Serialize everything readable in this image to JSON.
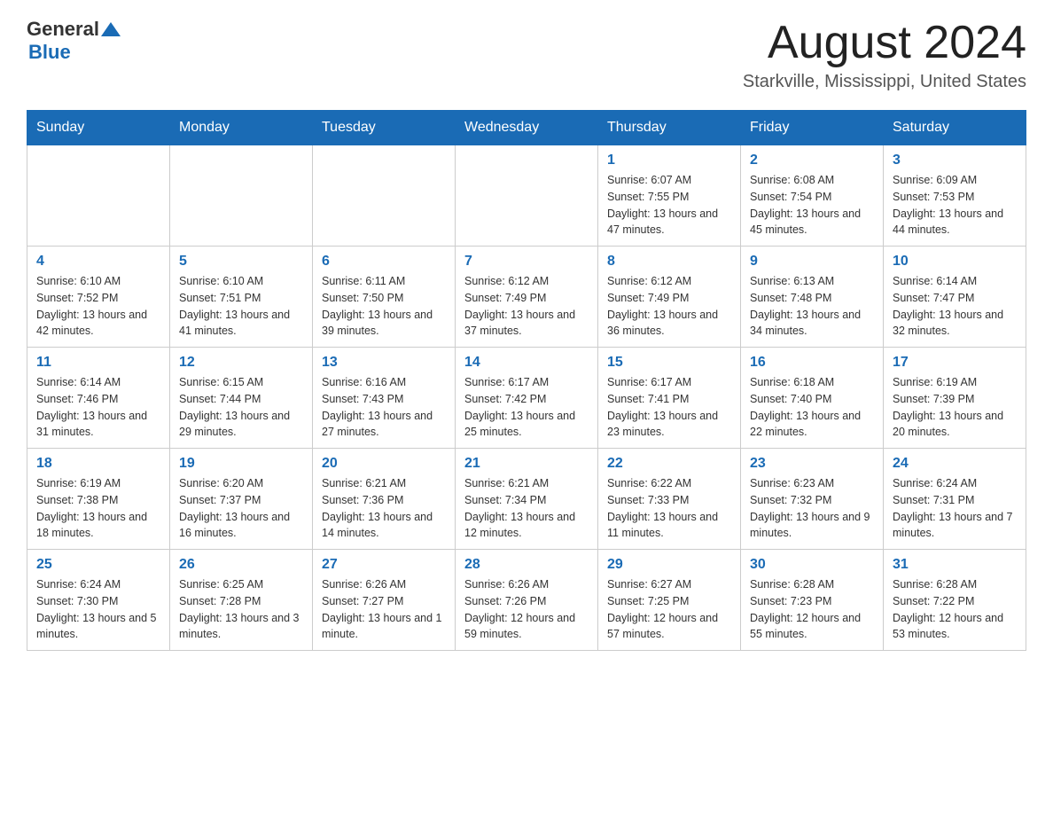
{
  "header": {
    "logo": {
      "general": "General",
      "blue": "Blue"
    },
    "title": "August 2024",
    "subtitle": "Starkville, Mississippi, United States"
  },
  "calendar": {
    "days_of_week": [
      "Sunday",
      "Monday",
      "Tuesday",
      "Wednesday",
      "Thursday",
      "Friday",
      "Saturday"
    ],
    "weeks": [
      [
        {
          "day": "",
          "info": ""
        },
        {
          "day": "",
          "info": ""
        },
        {
          "day": "",
          "info": ""
        },
        {
          "day": "",
          "info": ""
        },
        {
          "day": "1",
          "info": "Sunrise: 6:07 AM\nSunset: 7:55 PM\nDaylight: 13 hours and 47 minutes."
        },
        {
          "day": "2",
          "info": "Sunrise: 6:08 AM\nSunset: 7:54 PM\nDaylight: 13 hours and 45 minutes."
        },
        {
          "day": "3",
          "info": "Sunrise: 6:09 AM\nSunset: 7:53 PM\nDaylight: 13 hours and 44 minutes."
        }
      ],
      [
        {
          "day": "4",
          "info": "Sunrise: 6:10 AM\nSunset: 7:52 PM\nDaylight: 13 hours and 42 minutes."
        },
        {
          "day": "5",
          "info": "Sunrise: 6:10 AM\nSunset: 7:51 PM\nDaylight: 13 hours and 41 minutes."
        },
        {
          "day": "6",
          "info": "Sunrise: 6:11 AM\nSunset: 7:50 PM\nDaylight: 13 hours and 39 minutes."
        },
        {
          "day": "7",
          "info": "Sunrise: 6:12 AM\nSunset: 7:49 PM\nDaylight: 13 hours and 37 minutes."
        },
        {
          "day": "8",
          "info": "Sunrise: 6:12 AM\nSunset: 7:49 PM\nDaylight: 13 hours and 36 minutes."
        },
        {
          "day": "9",
          "info": "Sunrise: 6:13 AM\nSunset: 7:48 PM\nDaylight: 13 hours and 34 minutes."
        },
        {
          "day": "10",
          "info": "Sunrise: 6:14 AM\nSunset: 7:47 PM\nDaylight: 13 hours and 32 minutes."
        }
      ],
      [
        {
          "day": "11",
          "info": "Sunrise: 6:14 AM\nSunset: 7:46 PM\nDaylight: 13 hours and 31 minutes."
        },
        {
          "day": "12",
          "info": "Sunrise: 6:15 AM\nSunset: 7:44 PM\nDaylight: 13 hours and 29 minutes."
        },
        {
          "day": "13",
          "info": "Sunrise: 6:16 AM\nSunset: 7:43 PM\nDaylight: 13 hours and 27 minutes."
        },
        {
          "day": "14",
          "info": "Sunrise: 6:17 AM\nSunset: 7:42 PM\nDaylight: 13 hours and 25 minutes."
        },
        {
          "day": "15",
          "info": "Sunrise: 6:17 AM\nSunset: 7:41 PM\nDaylight: 13 hours and 23 minutes."
        },
        {
          "day": "16",
          "info": "Sunrise: 6:18 AM\nSunset: 7:40 PM\nDaylight: 13 hours and 22 minutes."
        },
        {
          "day": "17",
          "info": "Sunrise: 6:19 AM\nSunset: 7:39 PM\nDaylight: 13 hours and 20 minutes."
        }
      ],
      [
        {
          "day": "18",
          "info": "Sunrise: 6:19 AM\nSunset: 7:38 PM\nDaylight: 13 hours and 18 minutes."
        },
        {
          "day": "19",
          "info": "Sunrise: 6:20 AM\nSunset: 7:37 PM\nDaylight: 13 hours and 16 minutes."
        },
        {
          "day": "20",
          "info": "Sunrise: 6:21 AM\nSunset: 7:36 PM\nDaylight: 13 hours and 14 minutes."
        },
        {
          "day": "21",
          "info": "Sunrise: 6:21 AM\nSunset: 7:34 PM\nDaylight: 13 hours and 12 minutes."
        },
        {
          "day": "22",
          "info": "Sunrise: 6:22 AM\nSunset: 7:33 PM\nDaylight: 13 hours and 11 minutes."
        },
        {
          "day": "23",
          "info": "Sunrise: 6:23 AM\nSunset: 7:32 PM\nDaylight: 13 hours and 9 minutes."
        },
        {
          "day": "24",
          "info": "Sunrise: 6:24 AM\nSunset: 7:31 PM\nDaylight: 13 hours and 7 minutes."
        }
      ],
      [
        {
          "day": "25",
          "info": "Sunrise: 6:24 AM\nSunset: 7:30 PM\nDaylight: 13 hours and 5 minutes."
        },
        {
          "day": "26",
          "info": "Sunrise: 6:25 AM\nSunset: 7:28 PM\nDaylight: 13 hours and 3 minutes."
        },
        {
          "day": "27",
          "info": "Sunrise: 6:26 AM\nSunset: 7:27 PM\nDaylight: 13 hours and 1 minute."
        },
        {
          "day": "28",
          "info": "Sunrise: 6:26 AM\nSunset: 7:26 PM\nDaylight: 12 hours and 59 minutes."
        },
        {
          "day": "29",
          "info": "Sunrise: 6:27 AM\nSunset: 7:25 PM\nDaylight: 12 hours and 57 minutes."
        },
        {
          "day": "30",
          "info": "Sunrise: 6:28 AM\nSunset: 7:23 PM\nDaylight: 12 hours and 55 minutes."
        },
        {
          "day": "31",
          "info": "Sunrise: 6:28 AM\nSunset: 7:22 PM\nDaylight: 12 hours and 53 minutes."
        }
      ]
    ]
  }
}
